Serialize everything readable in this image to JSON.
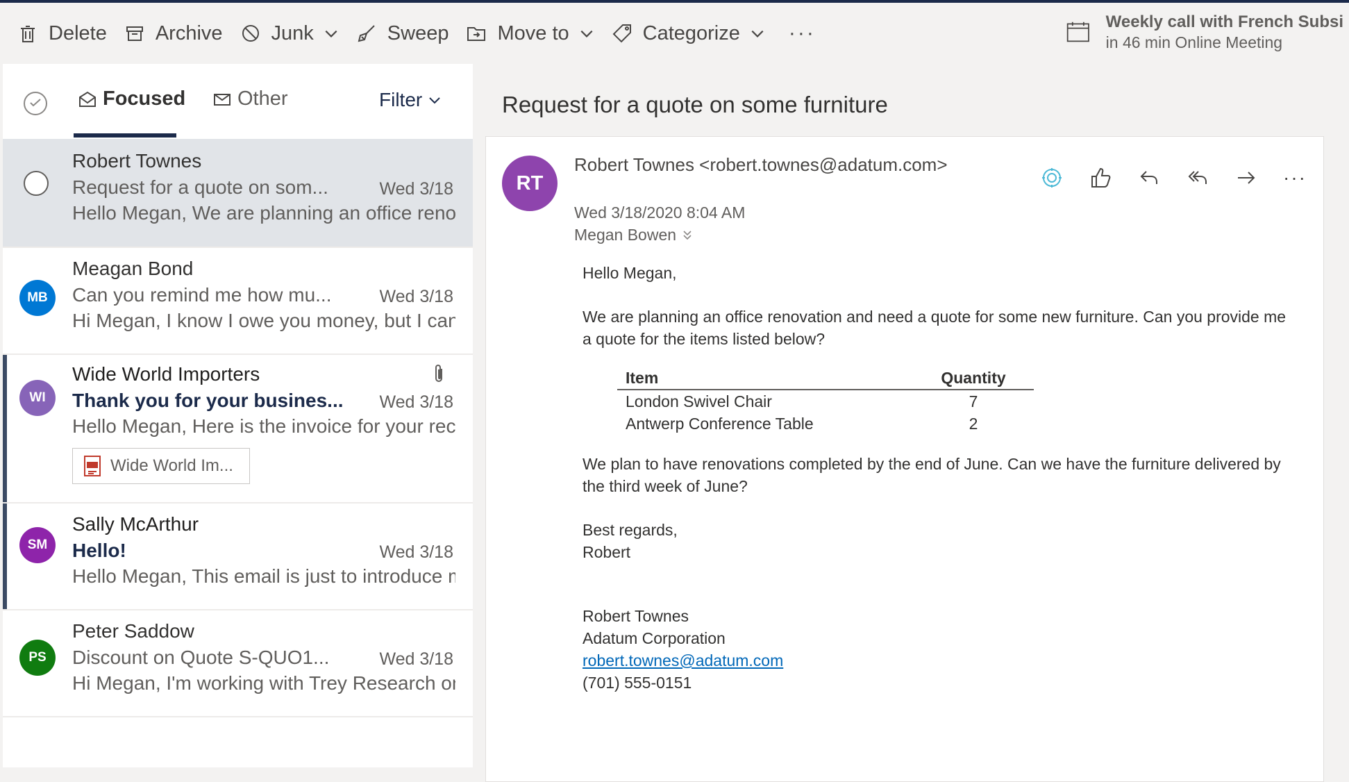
{
  "toolbar": {
    "delete": "Delete",
    "archive": "Archive",
    "junk": "Junk",
    "sweep": "Sweep",
    "move_to": "Move to",
    "categorize": "Categorize",
    "more": "···"
  },
  "meeting": {
    "title": "Weekly call with French Subsi",
    "subtitle": "in 46 min Online Meeting"
  },
  "tabs": {
    "focused": "Focused",
    "other": "Other",
    "filter": "Filter"
  },
  "messages": [
    {
      "initials": "",
      "sender": "Robert Townes",
      "subject": "Request for a quote on som...",
      "date": "Wed 3/18",
      "preview": "Hello Megan, We are planning an office renov"
    },
    {
      "initials": "MB",
      "sender": "Meagan Bond",
      "subject": "Can you remind me how mu...",
      "date": "Wed 3/18",
      "preview": "Hi Megan, I know I owe you money, but I can'",
      "avatar_color": "#0078d4"
    },
    {
      "initials": "WI",
      "sender": "Wide World Importers",
      "subject": "Thank you for your busines...",
      "date": "Wed 3/18",
      "preview": "Hello Megan, Here is the invoice for your rece",
      "attachment": "Wide World Im...",
      "avatar_color": "#8764b8"
    },
    {
      "initials": "SM",
      "sender": "Sally McArthur",
      "subject": "Hello!",
      "date": "Wed 3/18",
      "preview": "Hello Megan, This email is just to introduce m",
      "avatar_color": "#8e24aa"
    },
    {
      "initials": "PS",
      "sender": "Peter Saddow",
      "subject": "Discount on Quote S-QUO1...",
      "date": "Wed 3/18",
      "preview": "Hi Megan, I'm working with Trey Research on",
      "avatar_color": "#107c10"
    }
  ],
  "reading": {
    "subject": "Request for a quote on some furniture",
    "avatar_initials": "RT",
    "from": "Robert Townes <robert.townes@adatum.com>",
    "sent": "Wed 3/18/2020 8:04 AM",
    "to": "Megan Bowen",
    "actions_more": "···",
    "greeting": "Hello Megan,",
    "para1": "We are planning an office renovation and need a quote for some new furniture. Can you provide me a quote for the items listed below?",
    "table": {
      "headers": [
        "Item",
        "Quantity"
      ],
      "rows": [
        [
          "London Swivel Chair",
          "7"
        ],
        [
          "Antwerp Conference Table",
          "2"
        ]
      ]
    },
    "para2": "We plan to have renovations completed by the end of June. Can we have the furniture delivered by the third week of June?",
    "closing": "Best regards,",
    "closing_name": "Robert",
    "sig_name": "Robert Townes",
    "sig_company": "Adatum Corporation",
    "sig_email": "robert.townes@adatum.com",
    "sig_phone": "(701) 555-0151"
  }
}
